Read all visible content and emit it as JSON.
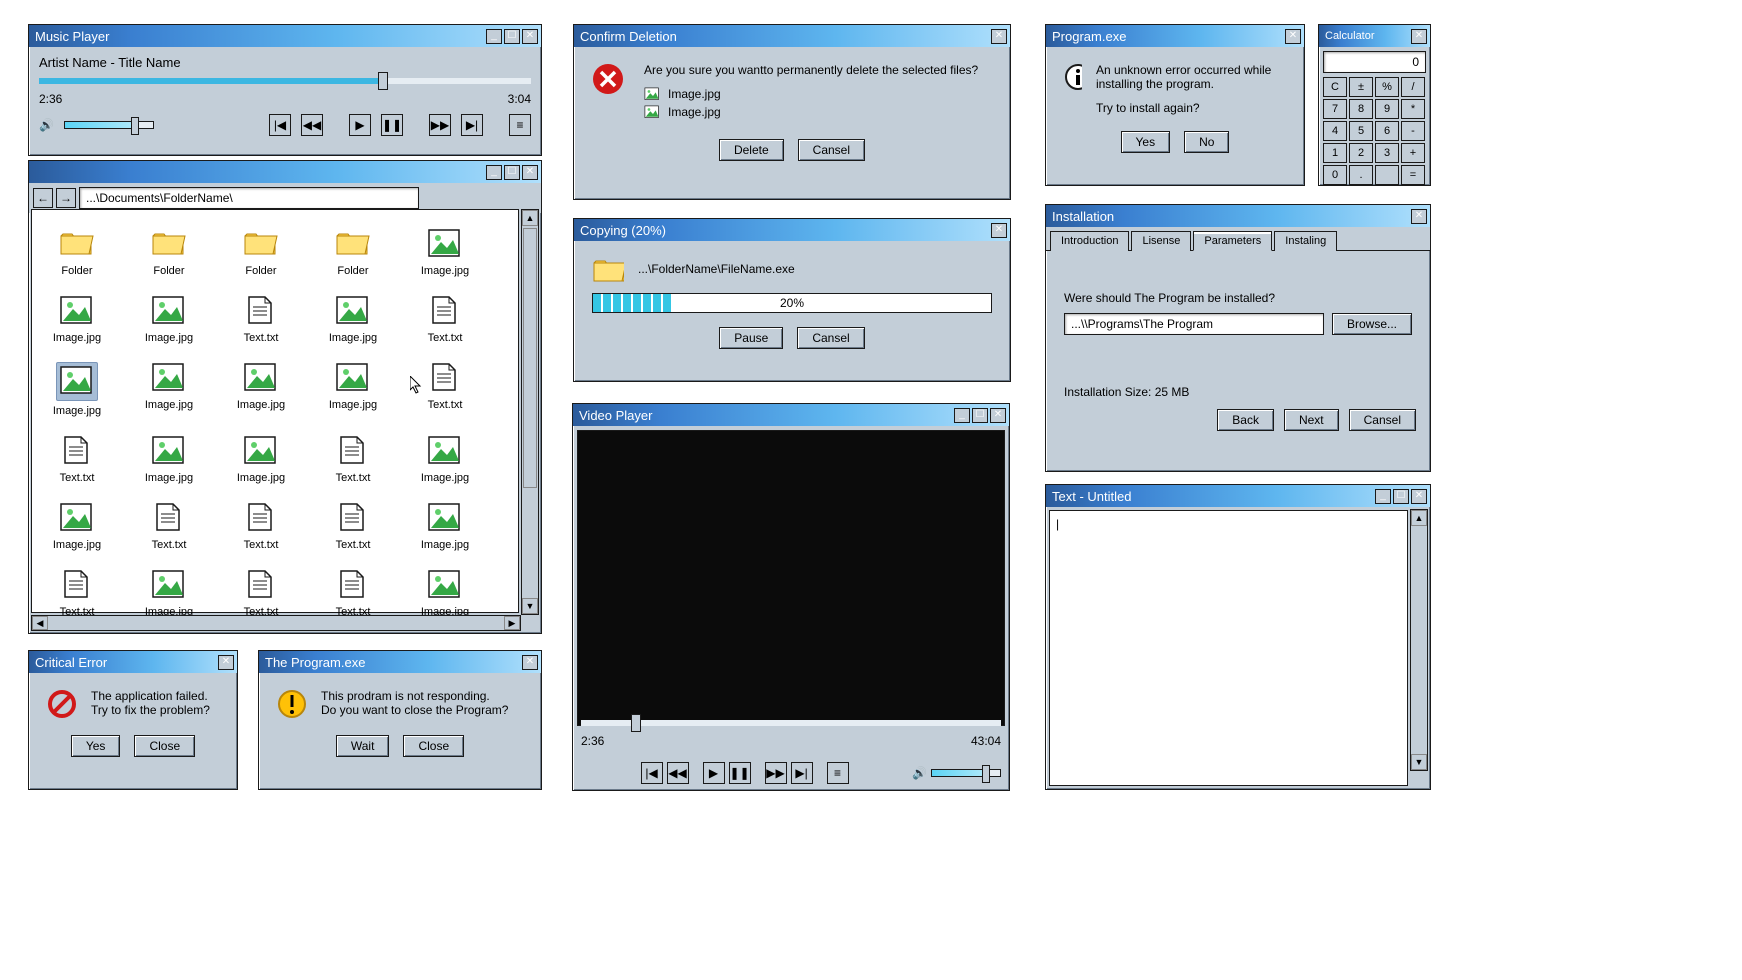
{
  "musicPlayer": {
    "title": "Music Player",
    "track": "Artist Name - Title Name",
    "elapsed": "2:36",
    "total": "3:04",
    "progressPct": 70,
    "volumePct": 80
  },
  "explorer": {
    "path": "...\\Documents\\FolderName\\",
    "selectedIndex": 10,
    "items": [
      {
        "type": "folder",
        "name": "Folder"
      },
      {
        "type": "folder",
        "name": "Folder"
      },
      {
        "type": "folder",
        "name": "Folder"
      },
      {
        "type": "folder",
        "name": "Folder"
      },
      {
        "type": "img",
        "name": "Image.jpg"
      },
      {
        "type": "img",
        "name": "Image.jpg"
      },
      {
        "type": "img",
        "name": "Image.jpg"
      },
      {
        "type": "txt",
        "name": "Text.txt"
      },
      {
        "type": "img",
        "name": "Image.jpg"
      },
      {
        "type": "txt",
        "name": "Text.txt"
      },
      {
        "type": "img",
        "name": "Image.jpg"
      },
      {
        "type": "img",
        "name": "Image.jpg"
      },
      {
        "type": "img",
        "name": "Image.jpg"
      },
      {
        "type": "img",
        "name": "Image.jpg"
      },
      {
        "type": "txt",
        "name": "Text.txt"
      },
      {
        "type": "txt",
        "name": "Text.txt"
      },
      {
        "type": "img",
        "name": "Image.jpg"
      },
      {
        "type": "img",
        "name": "Image.jpg"
      },
      {
        "type": "txt",
        "name": "Text.txt"
      },
      {
        "type": "img",
        "name": "Image.jpg"
      },
      {
        "type": "img",
        "name": "Image.jpg"
      },
      {
        "type": "txt",
        "name": "Text.txt"
      },
      {
        "type": "txt",
        "name": "Text.txt"
      },
      {
        "type": "txt",
        "name": "Text.txt"
      },
      {
        "type": "img",
        "name": "Image.jpg"
      },
      {
        "type": "txt",
        "name": "Text.txt"
      },
      {
        "type": "img",
        "name": "Image.jpg"
      },
      {
        "type": "txt",
        "name": "Text.txt"
      },
      {
        "type": "txt",
        "name": "Text.txt"
      },
      {
        "type": "img",
        "name": "Image.jpg"
      }
    ]
  },
  "criticalError": {
    "title": "Critical Error",
    "line1": "The application failed.",
    "line2": "Try to fix the problem?",
    "yes": "Yes",
    "close": "Close"
  },
  "notResponding": {
    "title": "The Program.exe",
    "line1": "This prodram is not responding.",
    "line2": "Do you want to close the Program?",
    "wait": "Wait",
    "close": "Close"
  },
  "confirmDelete": {
    "title": "Confirm Deletion",
    "message": "Are you sure you wantto permanently delete the selected files?",
    "files": [
      "Image.jpg",
      "Image.jpg"
    ],
    "delete": "Delete",
    "cancel": "Cansel"
  },
  "copying": {
    "title": "Copying (20%)",
    "path": "...\\FolderName\\FileName.exe",
    "percentLabel": "20%",
    "percent": 20,
    "pause": "Pause",
    "cancel": "Cansel"
  },
  "videoPlayer": {
    "title": "Video Player",
    "elapsed": "2:36",
    "total": "43:04",
    "progressPct": 13,
    "volumePct": 80
  },
  "programError": {
    "title": "Program.exe",
    "line1": "An unknown error occurred while installing the program.",
    "line2": "Try to install again?",
    "yes": "Yes",
    "no": "No"
  },
  "calculator": {
    "title": "Calculator",
    "display": "0",
    "keys": [
      "C",
      "±",
      "%",
      "/",
      "7",
      "8",
      "9",
      "*",
      "4",
      "5",
      "6",
      "-",
      "1",
      "2",
      "3",
      "+",
      "0",
      ".",
      "",
      "="
    ]
  },
  "installation": {
    "title": "Installation",
    "tabs": [
      "Introduction",
      "Lisense",
      "Parameters",
      "Instaling"
    ],
    "activeTab": 2,
    "question": "Were should The Program be installed?",
    "path": "...\\\\Programs\\The Program",
    "browse": "Browse...",
    "sizeLabel": "Installation Size: 25 MB",
    "back": "Back",
    "next": "Next",
    "cancel": "Cansel"
  },
  "notepad": {
    "title": "Text - Untitled",
    "content": "|"
  }
}
